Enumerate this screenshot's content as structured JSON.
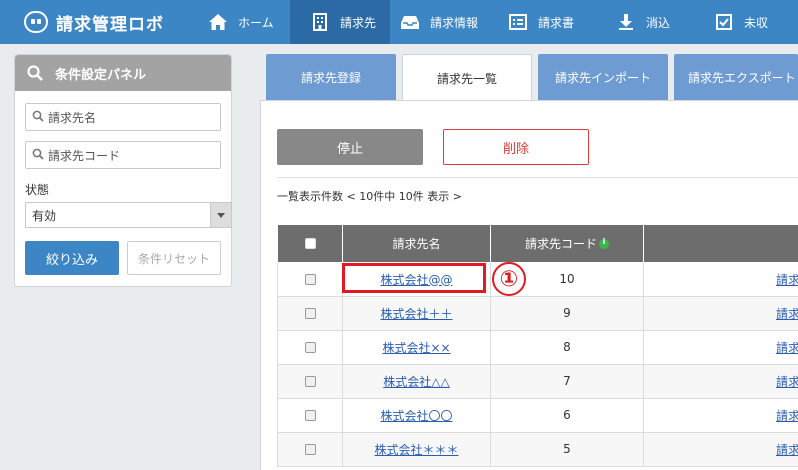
{
  "app": {
    "logo_text": "請求管理ロボ"
  },
  "nav": [
    {
      "label": "ホーム",
      "icon": "home-icon",
      "active": false
    },
    {
      "label": "請求先",
      "icon": "building-icon",
      "active": true
    },
    {
      "label": "請求情報",
      "icon": "inbox-icon",
      "active": false
    },
    {
      "label": "請求書",
      "icon": "invoice-icon",
      "active": false
    },
    {
      "label": "消込",
      "icon": "download-icon",
      "active": false
    },
    {
      "label": "未収",
      "icon": "checkbox-icon",
      "active": false
    }
  ],
  "filter_panel": {
    "title": "条件設定パネル",
    "name_placeholder": "請求先名",
    "code_placeholder": "請求先コード",
    "status_label": "状態",
    "status_value": "有効",
    "filter_button": "絞り込み",
    "reset_button": "条件リセット"
  },
  "tabs": [
    {
      "label": "請求先登録",
      "active": false
    },
    {
      "label": "請求先一覧",
      "active": true
    },
    {
      "label": "請求先インポート",
      "active": false
    },
    {
      "label": "請求先エクスポート",
      "active": false
    }
  ],
  "actions": {
    "stop": "停止",
    "delete": "削除"
  },
  "summary": "一覧表示件数 < 10件中 10件 表示 >",
  "table": {
    "headers": {
      "name": "請求先名",
      "code": "請求先コード"
    },
    "link_text": "請求",
    "rows": [
      {
        "name": "株式会社@@",
        "code": "10"
      },
      {
        "name": "株式会社＋＋",
        "code": "9"
      },
      {
        "name": "株式会社××",
        "code": "8"
      },
      {
        "name": "株式会社△△",
        "code": "7"
      },
      {
        "name": "株式会社〇〇",
        "code": "6"
      },
      {
        "name": "株式会社＊＊＊",
        "code": "5"
      }
    ]
  },
  "annotation": {
    "step": "①"
  },
  "colors": {
    "nav_bg": "#3d86c6",
    "nav_active": "#2b6aa4",
    "tab_inactive": "#6f9bd3",
    "table_header": "#6d6d6d",
    "accent_red": "#e01a22"
  }
}
